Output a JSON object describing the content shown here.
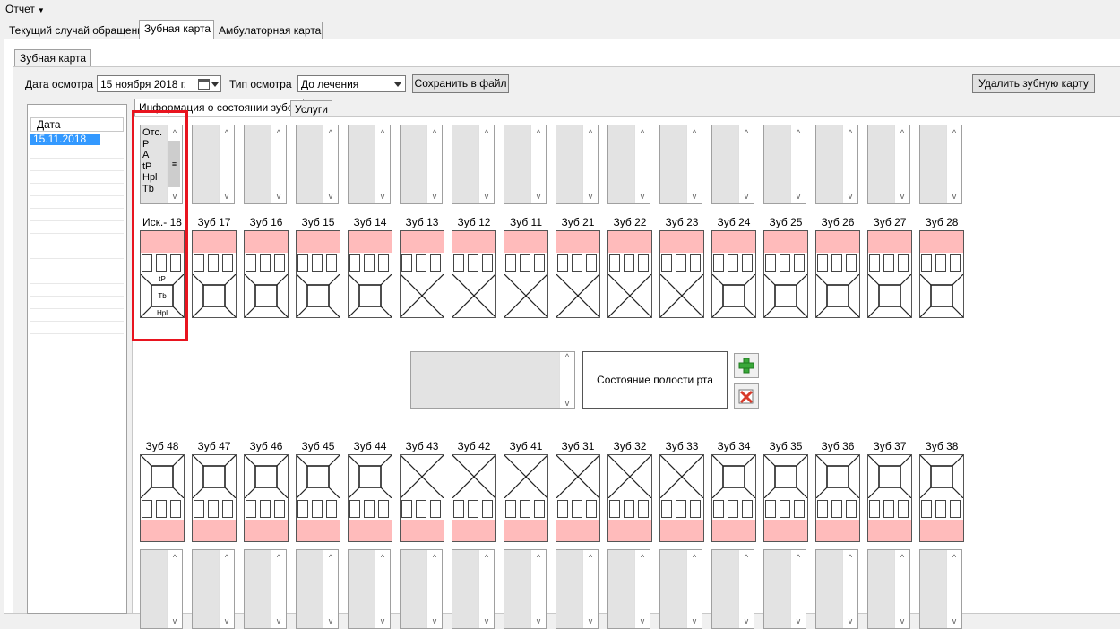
{
  "menu": {
    "report_label": "Отчет"
  },
  "tabs": [
    {
      "label": "Текущий случай обращения"
    },
    {
      "label": "Зубная карта"
    },
    {
      "label": "Амбулаторная карта"
    }
  ],
  "inner_tab": {
    "label": "Зубная карта"
  },
  "toolbar": {
    "exam_date_label": "Дата осмотра",
    "exam_date_value": "15   ноября   2018 г.",
    "exam_type_label": "Тип осмотра",
    "exam_type_value": "До лечения",
    "save_button": "Сохранить в файл",
    "delete_button": "Удалить зубную карту"
  },
  "date_list": {
    "header": "Дата",
    "rows": [
      "15.11.2018"
    ]
  },
  "chart_tabs": [
    {
      "label": "Информация о состоянии зубов"
    },
    {
      "label": "Услуги"
    }
  ],
  "first_listbox_items": [
    "Отс.",
    "P",
    "A",
    "tP",
    "Hpl",
    "Tb"
  ],
  "upper_teeth": [
    {
      "label": "Иск.- 18",
      "shape": "square",
      "marks": {
        "top": "tP",
        "center": "Tb",
        "bottom": "Hpl"
      }
    },
    {
      "label": "Зуб 17",
      "shape": "square"
    },
    {
      "label": "Зуб 16",
      "shape": "square"
    },
    {
      "label": "Зуб 15",
      "shape": "square"
    },
    {
      "label": "Зуб 14",
      "shape": "square"
    },
    {
      "label": "Зуб 13",
      "shape": "cross"
    },
    {
      "label": "Зуб 12",
      "shape": "cross"
    },
    {
      "label": "Зуб 11",
      "shape": "cross"
    },
    {
      "label": "Зуб 21",
      "shape": "cross"
    },
    {
      "label": "Зуб 22",
      "shape": "cross"
    },
    {
      "label": "Зуб 23",
      "shape": "cross"
    },
    {
      "label": "Зуб 24",
      "shape": "square"
    },
    {
      "label": "Зуб 25",
      "shape": "square"
    },
    {
      "label": "Зуб 26",
      "shape": "square"
    },
    {
      "label": "Зуб 27",
      "shape": "square"
    },
    {
      "label": "Зуб 28",
      "shape": "square"
    }
  ],
  "lower_teeth": [
    {
      "label": "Зуб 48",
      "shape": "square"
    },
    {
      "label": "Зуб 47",
      "shape": "square"
    },
    {
      "label": "Зуб 46",
      "shape": "square"
    },
    {
      "label": "Зуб 45",
      "shape": "square"
    },
    {
      "label": "Зуб 44",
      "shape": "square"
    },
    {
      "label": "Зуб 43",
      "shape": "cross"
    },
    {
      "label": "Зуб 42",
      "shape": "cross"
    },
    {
      "label": "Зуб 41",
      "shape": "cross"
    },
    {
      "label": "Зуб 31",
      "shape": "cross"
    },
    {
      "label": "Зуб 32",
      "shape": "cross"
    },
    {
      "label": "Зуб 33",
      "shape": "cross"
    },
    {
      "label": "Зуб 34",
      "shape": "square"
    },
    {
      "label": "Зуб 35",
      "shape": "square"
    },
    {
      "label": "Зуб 36",
      "shape": "square"
    },
    {
      "label": "Зуб 37",
      "shape": "square"
    },
    {
      "label": "Зуб 38",
      "shape": "square"
    }
  ],
  "mouth_state_button": "Состояние полости рта",
  "colors": {
    "crown_fill": "#ffbbbb",
    "selection": "#3399ff",
    "highlight_frame": "#e8141f",
    "add_icon": "#3aa83a",
    "remove_icon": "#d83a2a"
  }
}
